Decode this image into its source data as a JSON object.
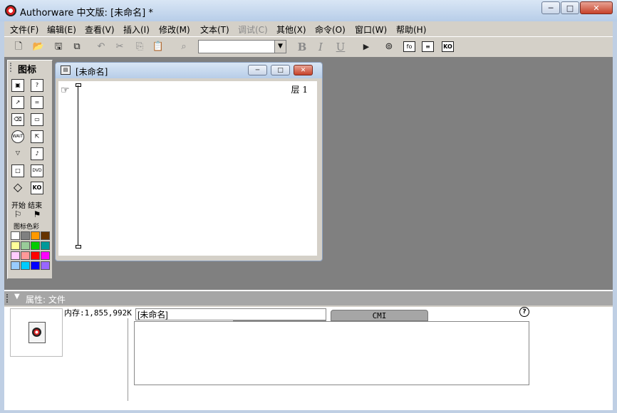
{
  "window": {
    "title": "Authorware 中文版: [未命名] *"
  },
  "caption_buttons": {
    "minimize": "─",
    "maximize": "□",
    "close": "✕"
  },
  "menu": [
    {
      "label": "文件(F)",
      "enabled": true
    },
    {
      "label": "编辑(E)",
      "enabled": true
    },
    {
      "label": "查看(V)",
      "enabled": true
    },
    {
      "label": "插入(I)",
      "enabled": true
    },
    {
      "label": "修改(M)",
      "enabled": true
    },
    {
      "label": "文本(T)",
      "enabled": true
    },
    {
      "label": "调试(C)",
      "enabled": false
    },
    {
      "label": "其他(X)",
      "enabled": true
    },
    {
      "label": "命令(O)",
      "enabled": true
    },
    {
      "label": "窗口(W)",
      "enabled": true
    },
    {
      "label": "帮助(H)",
      "enabled": true
    }
  ],
  "toolbar": {
    "font_select_value": "",
    "format_bold": "B",
    "format_italic": "I",
    "format_underline": "U",
    "box_fn": "fo",
    "box_list": "≡",
    "box_ko": "KO"
  },
  "icon_palette": {
    "title": "图标",
    "wait_label": "WAIT",
    "dvd_label": "DVD",
    "ko_label": "KO",
    "start_end_label": "开始 结束",
    "color_label": "图标色彩",
    "colors": [
      "#ffffff",
      "#808080",
      "#ff9900",
      "#663300",
      "#ffff99",
      "#99cc99",
      "#00cc00",
      "#009999",
      "#ffccff",
      "#ff9999",
      "#ff0000",
      "#ff00ff",
      "#99ccff",
      "#00ccff",
      "#0000ff",
      "#9966ff"
    ]
  },
  "flow_window": {
    "title": "[未命名]",
    "layer_label": "层 1"
  },
  "properties": {
    "header": "属性: 文件",
    "memory": "内存:1,855,992K",
    "file_name_value": "[未命名]",
    "tab_cmi": "CMI",
    "help": "?"
  }
}
